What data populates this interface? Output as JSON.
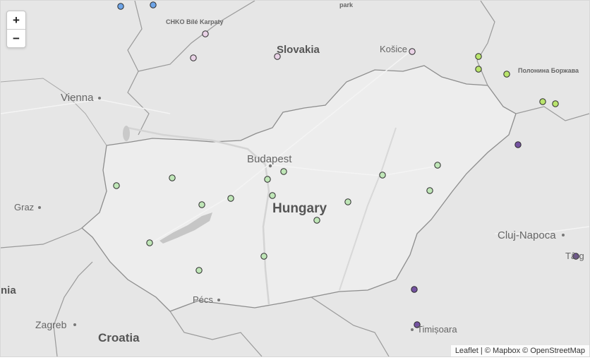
{
  "map": {
    "zoom_in_label": "+",
    "zoom_out_label": "−",
    "labels": {
      "park": "park",
      "chko": "CHKO Bílé Karpaty",
      "slovakia": "Slovakia",
      "kosice": "Košice",
      "polonyna": "Полонина Боржава",
      "vienna": "Vienna",
      "budapest": "Budapest",
      "graz": "Graz",
      "hungary": "Hungary",
      "cluj": "Cluj-Napoca",
      "targu": "Târg",
      "slovenia_partial": "nia",
      "pecs": "Pécs",
      "zagreb": "Zagreb",
      "croatia": "Croatia",
      "timisoara": "Timișoara"
    },
    "attribution": {
      "leaflet": "Leaflet",
      "separator": " | © ",
      "mapbox": "Mapbox",
      "copy2": " © ",
      "osm": "OpenStreetMap"
    },
    "colors": {
      "blue": "#6ea5e8",
      "pink": "#e9d2e6",
      "lime": "#b9e46c",
      "green": "#bfe6b7",
      "purple": "#7452a0"
    },
    "markers": [
      {
        "color": "blue"
      },
      {
        "color": "blue"
      },
      {
        "color": "pink"
      },
      {
        "color": "pink"
      },
      {
        "color": "pink"
      },
      {
        "color": "pink"
      },
      {
        "color": "lime"
      },
      {
        "color": "lime"
      },
      {
        "color": "lime"
      },
      {
        "color": "lime"
      },
      {
        "color": "lime"
      },
      {
        "color": "purple"
      },
      {
        "color": "purple"
      },
      {
        "color": "purple"
      },
      {
        "color": "purple"
      },
      {
        "color": "green"
      },
      {
        "color": "green"
      },
      {
        "color": "green"
      },
      {
        "color": "green"
      },
      {
        "color": "green"
      },
      {
        "color": "green"
      },
      {
        "color": "green"
      },
      {
        "color": "green"
      },
      {
        "color": "green"
      },
      {
        "color": "green"
      },
      {
        "color": "green"
      },
      {
        "color": "green"
      },
      {
        "color": "green"
      },
      {
        "color": "green"
      },
      {
        "color": "green"
      }
    ]
  }
}
